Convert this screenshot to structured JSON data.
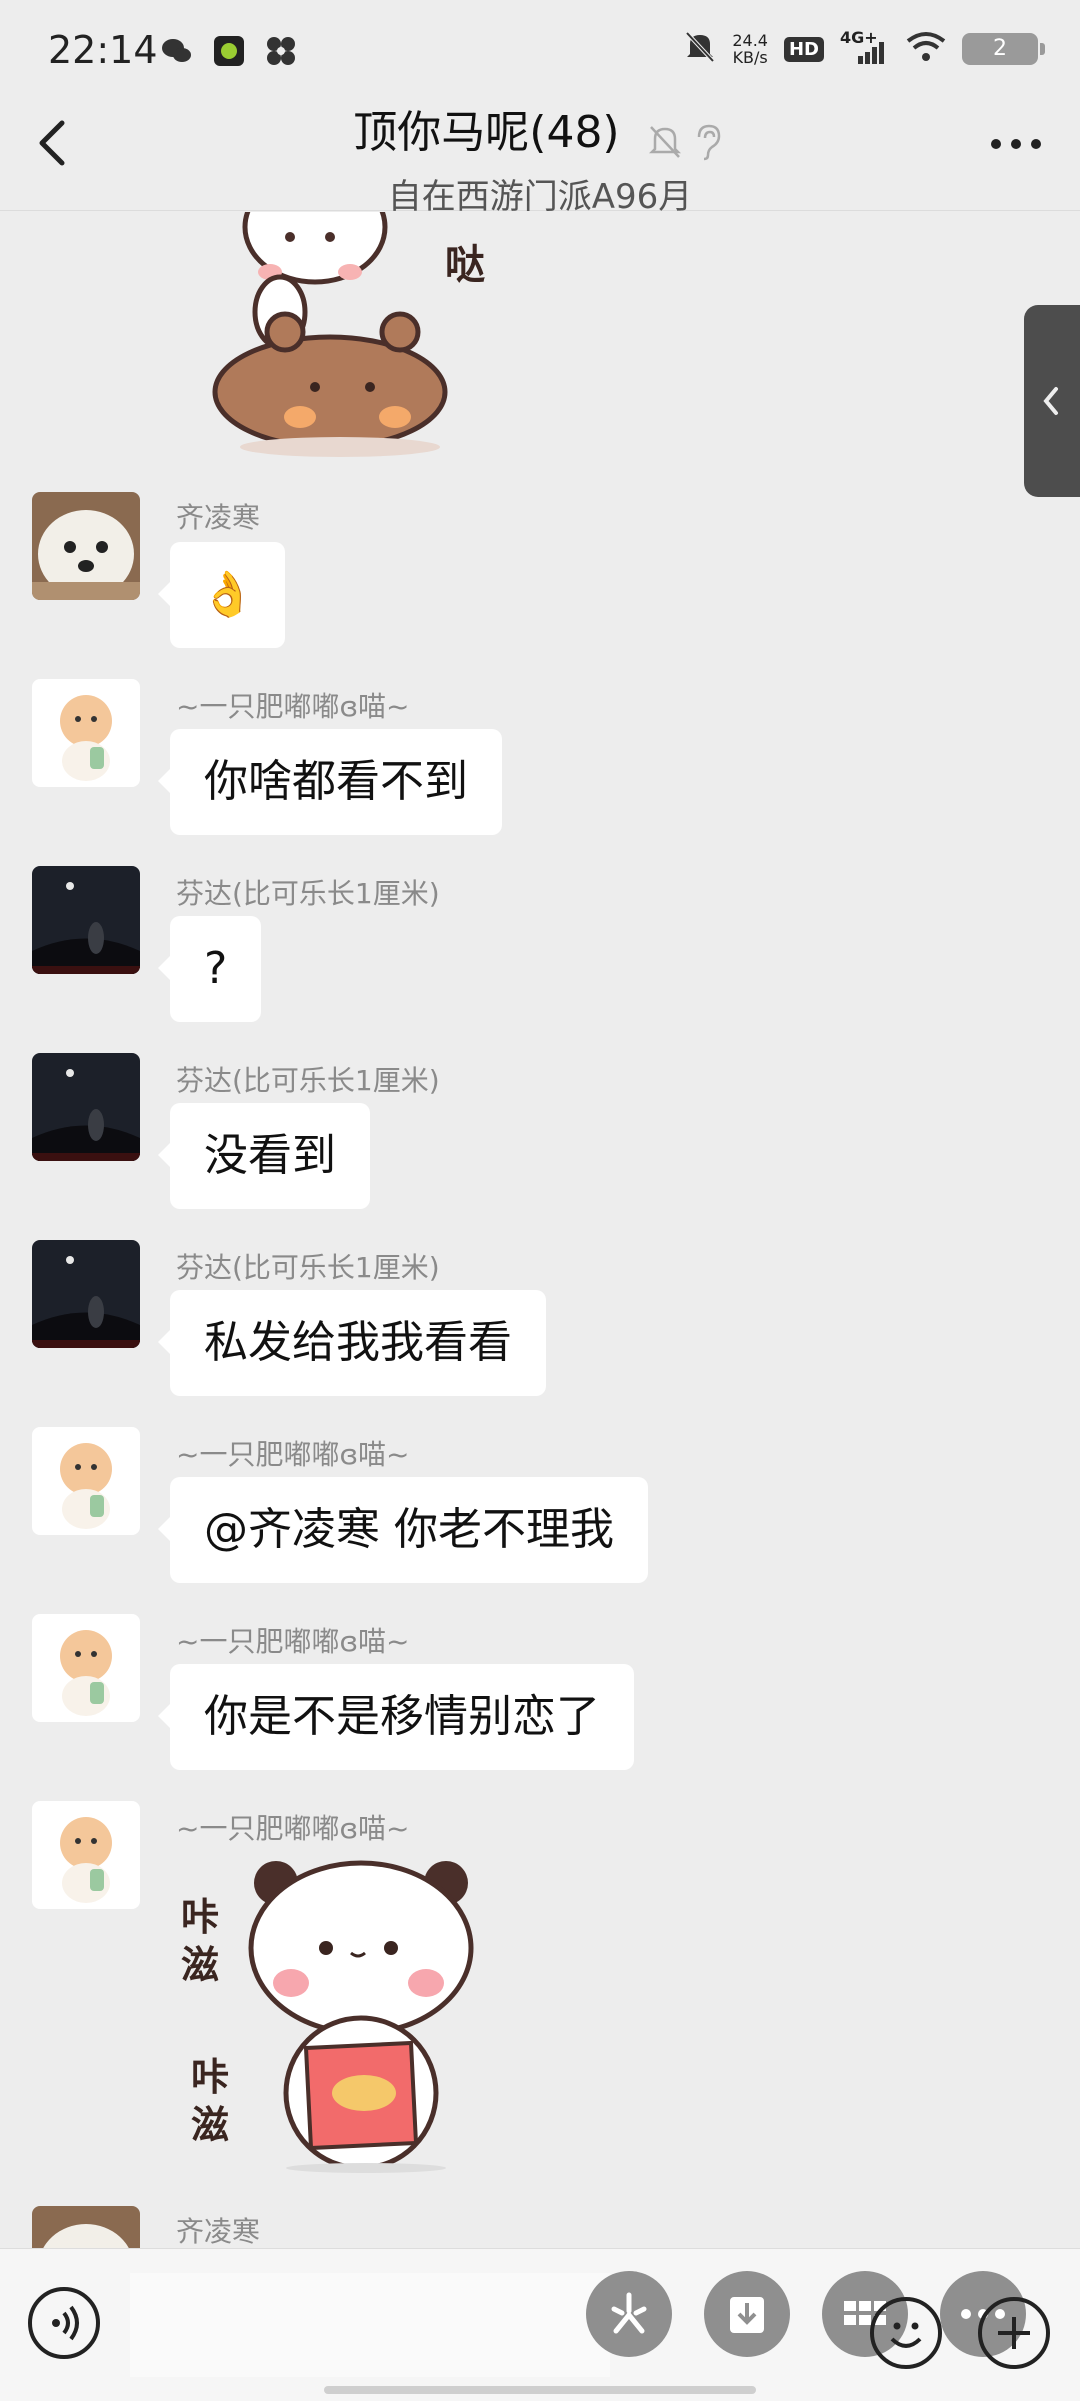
{
  "status_bar": {
    "time": "22:14",
    "speed_value": "24.4",
    "speed_unit": "KB/s",
    "hd": "HD",
    "network": "4G+",
    "battery": "2"
  },
  "header": {
    "title": "顶你马呢(48)",
    "subtitle": "自在西游门派A96月"
  },
  "messages": [
    {
      "sender": "齐凌寒",
      "text": "👌"
    },
    {
      "sender": "~一只肥嘟嘟ɞ喵~",
      "text": "你啥都看不到"
    },
    {
      "sender": "芬达(比可乐长1厘米)",
      "text": "?"
    },
    {
      "sender": "芬达(比可乐长1厘米)",
      "text": "没看到"
    },
    {
      "sender": "芬达(比可乐长1厘米)",
      "text": "私发给我我看看"
    },
    {
      "sender": "~一只肥嘟嘟ɞ喵~",
      "text": "@齐凌寒  你老不理我"
    },
    {
      "sender": "~一只肥嘟嘟ɞ喵~",
      "text": "你是不是移情别恋了"
    },
    {
      "sender": "~一只肥嘟嘟ɞ喵~",
      "text": ""
    },
    {
      "sender": "齐凌寒",
      "text": ""
    }
  ],
  "stickers": {
    "top_text": "哒",
    "bottom_text_1": "咔\n滋",
    "bottom_text_2": "咔\n滋"
  },
  "colors": {
    "background": "#ededed",
    "bubble": "#ffffff",
    "accent_gray": "#8f8f8f"
  },
  "icons": [
    "back-icon",
    "mute-bell-icon",
    "earpiece-icon",
    "more-icon",
    "voice-icon",
    "emoji-icon",
    "plus-icon"
  ]
}
